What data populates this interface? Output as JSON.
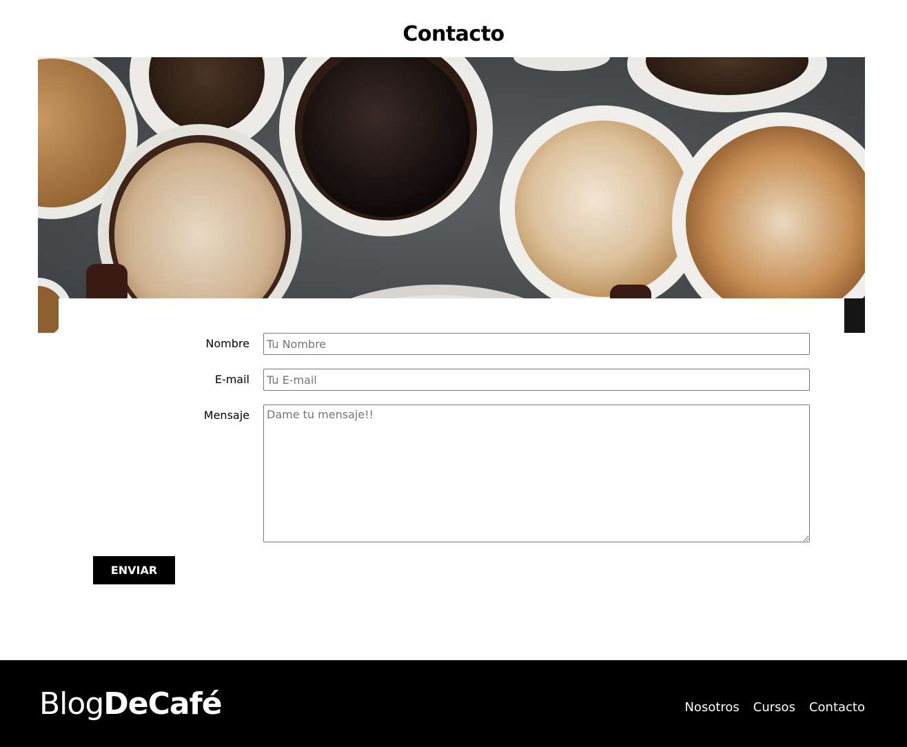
{
  "page": {
    "title": "Contacto"
  },
  "hero": {
    "icon": "coffee-cups-photo"
  },
  "form": {
    "name_label": "Nombre",
    "name_placeholder": "Tu Nombre",
    "name_value": "",
    "email_label": "E-mail",
    "email_placeholder": "Tu E-mail",
    "email_value": "",
    "message_label": "Mensaje",
    "message_placeholder": "Dame tu mensaje!!",
    "message_value": "",
    "submit_label": "Enviar"
  },
  "footer": {
    "logo_light": "Blog",
    "logo_bold": "DeCafé",
    "nav": [
      {
        "label": "Nosotros"
      },
      {
        "label": "Cursos"
      },
      {
        "label": "Contacto"
      }
    ]
  },
  "colors": {
    "footer_bg": "#000000",
    "button_bg": "#000000",
    "text": "#000000"
  }
}
